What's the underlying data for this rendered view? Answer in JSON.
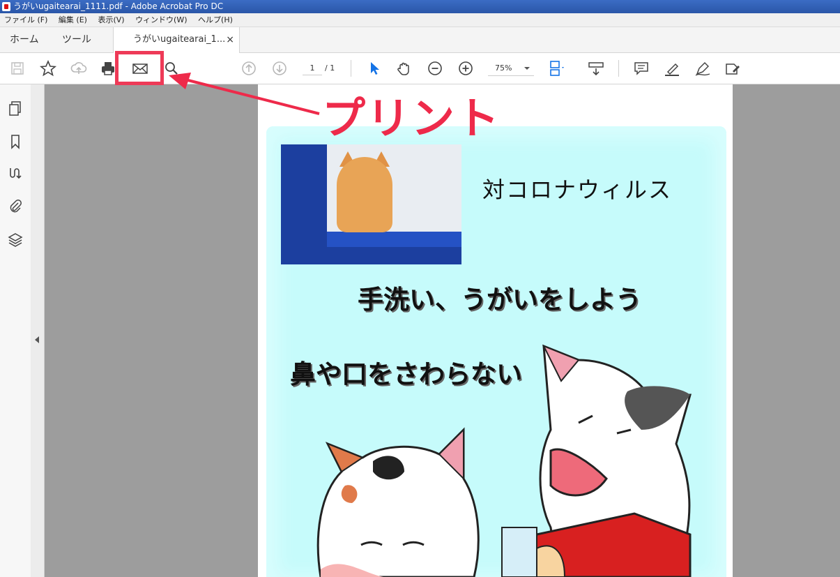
{
  "window": {
    "title": "うがいugaitearai_1111.pdf - Adobe Acrobat Pro DC"
  },
  "menu": [
    "ファイル (F)",
    "編集 (E)",
    "表示(V)",
    "ウィンドウ(W)",
    "ヘルプ(H)"
  ],
  "tabs": {
    "home": "ホーム",
    "tools": "ツール",
    "document": "うがいugaitearai_1...",
    "close": "×"
  },
  "toolbar": {
    "icons": [
      "save-icon",
      "star-icon",
      "upload-icon",
      "print-icon",
      "mail-icon",
      "search-icon",
      "page-up-icon",
      "page-down-icon",
      "select-cursor-icon",
      "hand-icon",
      "zoom-out-icon",
      "zoom-in-icon",
      "fit-page-icon",
      "scroll-mode-icon",
      "comment-icon",
      "highlight-icon",
      "sign-icon",
      "fill-sign-icon"
    ],
    "page_current": "1",
    "page_total": "/ 1",
    "zoom": "75%"
  },
  "sidebar": {
    "icons": [
      "pages-icon",
      "bookmark-icon",
      "link-icon",
      "attachment-icon",
      "layers-icon"
    ]
  },
  "document": {
    "heading1": "対コロナウィルス",
    "heading2": "手洗い、うがいをしよう",
    "heading3": "鼻や口をさわらない"
  },
  "annotation": {
    "label": "プリント",
    "color": "#ee2a4a"
  }
}
